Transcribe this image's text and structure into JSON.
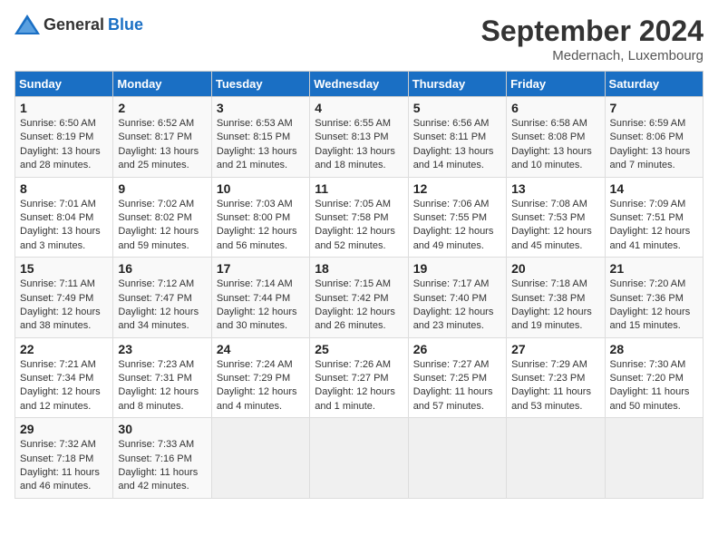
{
  "header": {
    "logo_general": "General",
    "logo_blue": "Blue",
    "month": "September 2024",
    "location": "Medernach, Luxembourg"
  },
  "weekdays": [
    "Sunday",
    "Monday",
    "Tuesday",
    "Wednesday",
    "Thursday",
    "Friday",
    "Saturday"
  ],
  "weeks": [
    [
      {
        "day": "1",
        "sunrise": "Sunrise: 6:50 AM",
        "sunset": "Sunset: 8:19 PM",
        "daylight": "Daylight: 13 hours and 28 minutes."
      },
      {
        "day": "2",
        "sunrise": "Sunrise: 6:52 AM",
        "sunset": "Sunset: 8:17 PM",
        "daylight": "Daylight: 13 hours and 25 minutes."
      },
      {
        "day": "3",
        "sunrise": "Sunrise: 6:53 AM",
        "sunset": "Sunset: 8:15 PM",
        "daylight": "Daylight: 13 hours and 21 minutes."
      },
      {
        "day": "4",
        "sunrise": "Sunrise: 6:55 AM",
        "sunset": "Sunset: 8:13 PM",
        "daylight": "Daylight: 13 hours and 18 minutes."
      },
      {
        "day": "5",
        "sunrise": "Sunrise: 6:56 AM",
        "sunset": "Sunset: 8:11 PM",
        "daylight": "Daylight: 13 hours and 14 minutes."
      },
      {
        "day": "6",
        "sunrise": "Sunrise: 6:58 AM",
        "sunset": "Sunset: 8:08 PM",
        "daylight": "Daylight: 13 hours and 10 minutes."
      },
      {
        "day": "7",
        "sunrise": "Sunrise: 6:59 AM",
        "sunset": "Sunset: 8:06 PM",
        "daylight": "Daylight: 13 hours and 7 minutes."
      }
    ],
    [
      {
        "day": "8",
        "sunrise": "Sunrise: 7:01 AM",
        "sunset": "Sunset: 8:04 PM",
        "daylight": "Daylight: 13 hours and 3 minutes."
      },
      {
        "day": "9",
        "sunrise": "Sunrise: 7:02 AM",
        "sunset": "Sunset: 8:02 PM",
        "daylight": "Daylight: 12 hours and 59 minutes."
      },
      {
        "day": "10",
        "sunrise": "Sunrise: 7:03 AM",
        "sunset": "Sunset: 8:00 PM",
        "daylight": "Daylight: 12 hours and 56 minutes."
      },
      {
        "day": "11",
        "sunrise": "Sunrise: 7:05 AM",
        "sunset": "Sunset: 7:58 PM",
        "daylight": "Daylight: 12 hours and 52 minutes."
      },
      {
        "day": "12",
        "sunrise": "Sunrise: 7:06 AM",
        "sunset": "Sunset: 7:55 PM",
        "daylight": "Daylight: 12 hours and 49 minutes."
      },
      {
        "day": "13",
        "sunrise": "Sunrise: 7:08 AM",
        "sunset": "Sunset: 7:53 PM",
        "daylight": "Daylight: 12 hours and 45 minutes."
      },
      {
        "day": "14",
        "sunrise": "Sunrise: 7:09 AM",
        "sunset": "Sunset: 7:51 PM",
        "daylight": "Daylight: 12 hours and 41 minutes."
      }
    ],
    [
      {
        "day": "15",
        "sunrise": "Sunrise: 7:11 AM",
        "sunset": "Sunset: 7:49 PM",
        "daylight": "Daylight: 12 hours and 38 minutes."
      },
      {
        "day": "16",
        "sunrise": "Sunrise: 7:12 AM",
        "sunset": "Sunset: 7:47 PM",
        "daylight": "Daylight: 12 hours and 34 minutes."
      },
      {
        "day": "17",
        "sunrise": "Sunrise: 7:14 AM",
        "sunset": "Sunset: 7:44 PM",
        "daylight": "Daylight: 12 hours and 30 minutes."
      },
      {
        "day": "18",
        "sunrise": "Sunrise: 7:15 AM",
        "sunset": "Sunset: 7:42 PM",
        "daylight": "Daylight: 12 hours and 26 minutes."
      },
      {
        "day": "19",
        "sunrise": "Sunrise: 7:17 AM",
        "sunset": "Sunset: 7:40 PM",
        "daylight": "Daylight: 12 hours and 23 minutes."
      },
      {
        "day": "20",
        "sunrise": "Sunrise: 7:18 AM",
        "sunset": "Sunset: 7:38 PM",
        "daylight": "Daylight: 12 hours and 19 minutes."
      },
      {
        "day": "21",
        "sunrise": "Sunrise: 7:20 AM",
        "sunset": "Sunset: 7:36 PM",
        "daylight": "Daylight: 12 hours and 15 minutes."
      }
    ],
    [
      {
        "day": "22",
        "sunrise": "Sunrise: 7:21 AM",
        "sunset": "Sunset: 7:34 PM",
        "daylight": "Daylight: 12 hours and 12 minutes."
      },
      {
        "day": "23",
        "sunrise": "Sunrise: 7:23 AM",
        "sunset": "Sunset: 7:31 PM",
        "daylight": "Daylight: 12 hours and 8 minutes."
      },
      {
        "day": "24",
        "sunrise": "Sunrise: 7:24 AM",
        "sunset": "Sunset: 7:29 PM",
        "daylight": "Daylight: 12 hours and 4 minutes."
      },
      {
        "day": "25",
        "sunrise": "Sunrise: 7:26 AM",
        "sunset": "Sunset: 7:27 PM",
        "daylight": "Daylight: 12 hours and 1 minute."
      },
      {
        "day": "26",
        "sunrise": "Sunrise: 7:27 AM",
        "sunset": "Sunset: 7:25 PM",
        "daylight": "Daylight: 11 hours and 57 minutes."
      },
      {
        "day": "27",
        "sunrise": "Sunrise: 7:29 AM",
        "sunset": "Sunset: 7:23 PM",
        "daylight": "Daylight: 11 hours and 53 minutes."
      },
      {
        "day": "28",
        "sunrise": "Sunrise: 7:30 AM",
        "sunset": "Sunset: 7:20 PM",
        "daylight": "Daylight: 11 hours and 50 minutes."
      }
    ],
    [
      {
        "day": "29",
        "sunrise": "Sunrise: 7:32 AM",
        "sunset": "Sunset: 7:18 PM",
        "daylight": "Daylight: 11 hours and 46 minutes."
      },
      {
        "day": "30",
        "sunrise": "Sunrise: 7:33 AM",
        "sunset": "Sunset: 7:16 PM",
        "daylight": "Daylight: 11 hours and 42 minutes."
      },
      {
        "day": "",
        "sunrise": "",
        "sunset": "",
        "daylight": ""
      },
      {
        "day": "",
        "sunrise": "",
        "sunset": "",
        "daylight": ""
      },
      {
        "day": "",
        "sunrise": "",
        "sunset": "",
        "daylight": ""
      },
      {
        "day": "",
        "sunrise": "",
        "sunset": "",
        "daylight": ""
      },
      {
        "day": "",
        "sunrise": "",
        "sunset": "",
        "daylight": ""
      }
    ]
  ]
}
